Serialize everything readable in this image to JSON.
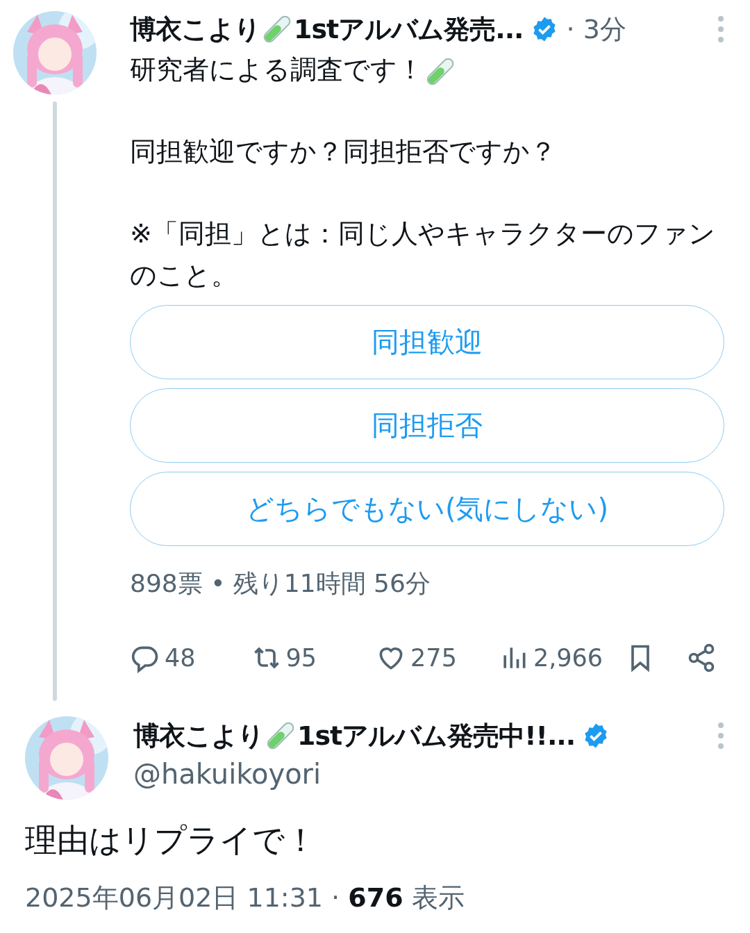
{
  "tweet": {
    "author": {
      "name": "博衣こより",
      "name_suffix": "1stアルバム発売...",
      "verified": true
    },
    "time": "· 3分",
    "first_line": "研究者による調査です！",
    "paragraphs": [
      "同担歓迎ですか？同担拒否ですか？",
      "※「同担」とは：同じ人やキャラクターのファンのこと。"
    ],
    "poll": {
      "options": [
        {
          "label": "同担歓迎"
        },
        {
          "label": "同担拒否"
        },
        {
          "label": "どちらでもない(気にしない)"
        }
      ],
      "summary": "898票 • 残り11時間 56分"
    },
    "actions": [
      {
        "kind": "reply",
        "count": "48"
      },
      {
        "kind": "retweet",
        "count": "95"
      },
      {
        "kind": "like",
        "count": "275"
      },
      {
        "kind": "views",
        "count": "2,966"
      },
      {
        "kind": "bookmark"
      },
      {
        "kind": "share"
      }
    ]
  },
  "reply": {
    "author": {
      "name": "博衣こより",
      "name_suffix": "1stアルバム発売中!!...",
      "verified": true,
      "handle": "@hakuikoyori"
    },
    "text": "理由はリプライで！",
    "date": "2025年06月02日 11:31 · ",
    "views": "676",
    "views_label": " 表示"
  }
}
